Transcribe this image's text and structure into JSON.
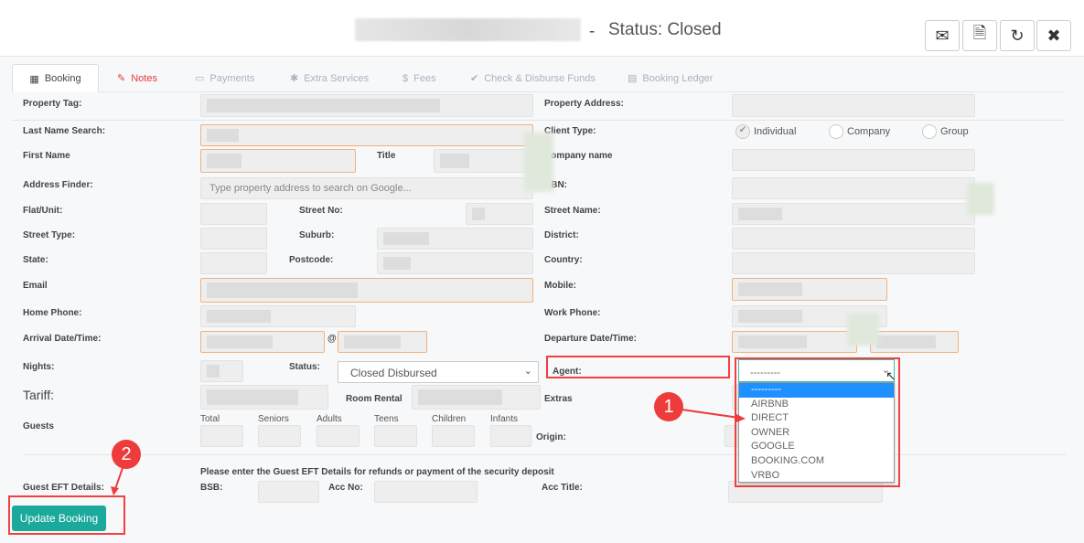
{
  "header": {
    "separator": "-",
    "status": "Status: Closed",
    "buttons": [
      {
        "icon": "envelope-icon",
        "glyph": "✉"
      },
      {
        "icon": "pdf-icon",
        "glyph": "🗎"
      },
      {
        "icon": "refresh-icon",
        "glyph": "↻"
      },
      {
        "icon": "close-icon",
        "glyph": "✖"
      }
    ]
  },
  "tabs": [
    {
      "label": "Booking",
      "glyph": "▦"
    },
    {
      "label": "Notes",
      "glyph": "✎"
    },
    {
      "label": "Payments",
      "glyph": "▭"
    },
    {
      "label": "Extra Services",
      "glyph": "✱"
    },
    {
      "label": "Fees",
      "glyph": "$"
    },
    {
      "label": "Check & Disburse Funds",
      "glyph": "✔"
    },
    {
      "label": "Booking Ledger",
      "glyph": "▤"
    }
  ],
  "colors": {
    "active_tab_notes": "#e8383d",
    "accent": "#1aa99b",
    "annotation": "#ee3b3b",
    "highlight": "#1e90ff"
  },
  "labels": {
    "property_tag": "Property Tag:",
    "last_name": "Last Name Search:",
    "first_name": "First Name",
    "title": "Title",
    "address_finder": "Address Finder:",
    "flat": "Flat/Unit:",
    "street_no": "Street No:",
    "street_type": "Street Type:",
    "suburb": "Suburb:",
    "state": "State:",
    "postcode": "Postcode:",
    "email": "Email",
    "home_phone": "Home Phone:",
    "arrival": "Arrival Date/Time:",
    "at": "@",
    "nights": "Nights:",
    "status": "Status:",
    "tariff": "Tariff:",
    "room_rental": "Room Rental",
    "guests": "Guests",
    "property_address": "Property Address:",
    "client_type": "Client Type:",
    "company_name": "Company name",
    "abn": "ABN:",
    "street_name": "Street Name:",
    "district": "District:",
    "country": "Country:",
    "mobile": "Mobile:",
    "work_phone": "Work Phone:",
    "departure": "Departure Date/Time:",
    "agent": "Agent:",
    "extras": "Extras",
    "origin": "Origin:",
    "eft_details": "Guest EFT Details:",
    "eft_note": "Please enter the Guest EFT Details for refunds or payment of the security deposit",
    "bsb": "BSB:",
    "acc_no": "Acc No:",
    "acc_title": "Acc Title:"
  },
  "address_placeholder": "Type property address to search on Google...",
  "client_types": [
    {
      "label": "Individual",
      "checked": true
    },
    {
      "label": "Company",
      "checked": false
    },
    {
      "label": "Group",
      "checked": false
    }
  ],
  "guest_columns": [
    "Total",
    "Seniors",
    "Adults",
    "Teens",
    "Children",
    "Infants"
  ],
  "status_value": "Closed Disbursed",
  "agent": {
    "selected": "---------",
    "options": [
      "---------",
      "AIRBNB",
      "DIRECT",
      "OWNER",
      "GOOGLE",
      "BOOKING.COM",
      "VRBO"
    ],
    "highlighted": "---------"
  },
  "update_button": "Update Booking",
  "annotations": [
    "1",
    "2"
  ]
}
